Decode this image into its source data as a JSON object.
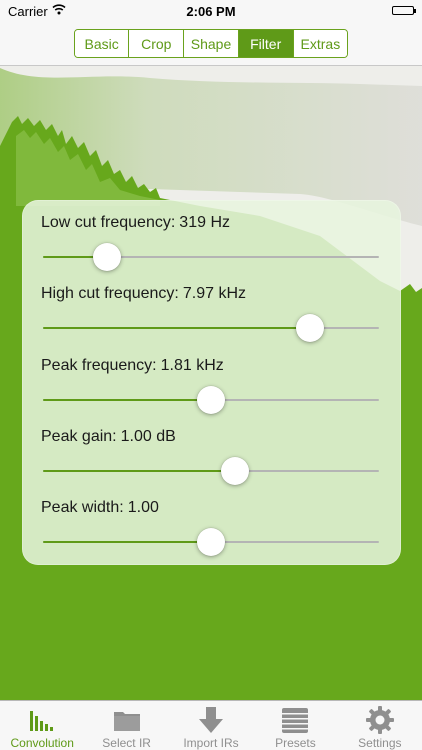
{
  "status_bar": {
    "carrier": "Carrier",
    "time": "2:06 PM"
  },
  "segments": [
    {
      "label": "Basic",
      "active": false
    },
    {
      "label": "Crop",
      "active": false
    },
    {
      "label": "Shape",
      "active": false
    },
    {
      "label": "Filter",
      "active": true
    },
    {
      "label": "Extras",
      "active": false
    }
  ],
  "filter": {
    "low_cut": {
      "label": "Low cut frequency:",
      "value": "319 Hz",
      "level": 0.19
    },
    "high_cut": {
      "label": "High cut frequency:",
      "value": "7.97 kHz",
      "level": 0.795
    },
    "peak_frequency": {
      "label": "Peak frequency:",
      "value": "1.81 kHz",
      "level": 0.5
    },
    "peak_gain": {
      "label": "Peak gain:",
      "value": "1.00 dB",
      "level": 0.57
    },
    "peak_width": {
      "label": "Peak width:",
      "value": "1.00",
      "level": 0.5
    }
  },
  "tabs": [
    {
      "label": "Convolution",
      "icon": "bar-chart-icon",
      "active": true
    },
    {
      "label": "Select IR",
      "icon": "folder-icon",
      "active": false
    },
    {
      "label": "Import IRs",
      "icon": "download-arrow-icon",
      "active": false
    },
    {
      "label": "Presets",
      "icon": "table-list-icon",
      "active": false
    },
    {
      "label": "Settings",
      "icon": "gear-icon",
      "active": false
    }
  ],
  "colors": {
    "accent": "#5f9a18",
    "graph_green": "#67a81c",
    "graph_light": "#8cc04a",
    "panel": "#e8f4de",
    "inactive": "#8f8f8f"
  }
}
